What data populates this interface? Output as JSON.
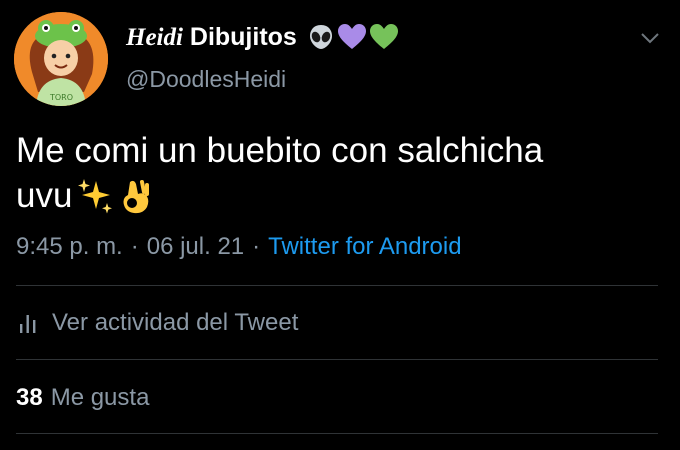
{
  "tweet": {
    "author": {
      "name_italic": "Heidi",
      "name_rest": " Dibujitos",
      "handle": "@DoodlesHeidi",
      "name_emojis": [
        "alien-icon",
        "purple-heart-icon",
        "green-heart-icon"
      ],
      "avatar_shirt_text": "TORO"
    },
    "text_line1": "Me comi un buebito con salchicha",
    "text_line2": "uvu",
    "text_emojis": [
      "sparkles-icon",
      "ok-hand-icon"
    ],
    "time": "9:45 p. m.",
    "separator": "·",
    "date": "06 jul. 21",
    "source": "Twitter for Android",
    "activity_label": "Ver actividad del Tweet",
    "likes_count": "38",
    "likes_label": "Me gusta"
  },
  "colors": {
    "background": "#000000",
    "text_primary": "#ffffff",
    "text_secondary": "#8b98a5",
    "link": "#1d9bf0",
    "divider": "#2f3336",
    "avatar_bg": "#f08a2a"
  }
}
